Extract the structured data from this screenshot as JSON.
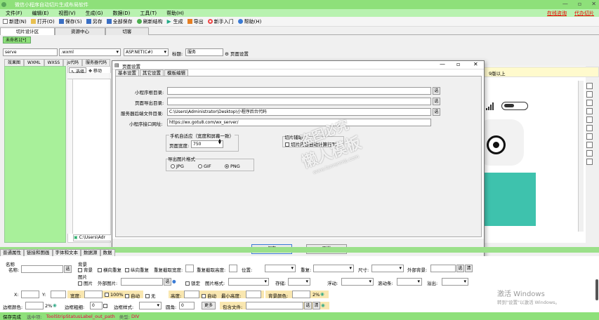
{
  "app": {
    "title": "微信小程序自动切片生成布局软件",
    "window_buttons": [
      "—",
      "▫",
      "✕"
    ]
  },
  "menu": {
    "items": [
      "文件(F)",
      "编辑(E)",
      "视图(V)",
      "生成(G)",
      "数据(D)",
      "工具(T)",
      "帮助(H)"
    ],
    "right_links": [
      "在线咨询",
      "代办切片"
    ]
  },
  "toolbar": {
    "items": [
      "新建(N)",
      "打开(O)",
      "保存(S)",
      "另存",
      "全部保存",
      "刷新结构",
      "生成",
      "导出",
      "新手入门",
      "帮助(H)"
    ]
  },
  "main_tabs": [
    "切片设计区",
    "资源中心",
    "切客"
  ],
  "doc_tab": "未命名1[*]",
  "filebar": {
    "name_value": "serve",
    "ext_value": ".wxml",
    "lang_value": "ASP.NET(C#)",
    "title_label": "标题:",
    "title_value": "服务",
    "page_settings": "页面设置"
  },
  "side_tabs": [
    "效果图",
    "WXML",
    "WXSS",
    "js代码",
    "服务器代码"
  ],
  "design_tools": {
    "select": "选择",
    "move": "移动"
  },
  "path_bottom": "C:\\Users\\Adr",
  "yellow_hint": "9版以上",
  "dialog": {
    "title": "页面设置",
    "tabs": [
      "基本设置",
      "其它设置",
      "模板编辑"
    ],
    "fields": [
      {
        "label": "小程序根目录:",
        "value": "",
        "btn": "选"
      },
      {
        "label": "页面导出目录:",
        "value": "",
        "btn": "选"
      },
      {
        "label": "服务器后端文件目录:",
        "value": "C:\\Users\\Administrator\\Desktop\\小程序后台代码",
        "btn": "选"
      },
      {
        "label": "小程序接口网址:",
        "value": "https://wx.gotu8.com/wx_server/",
        "btn": ""
      }
    ],
    "group_adapt": {
      "title": "手机自适应（宽度和屏幕一致）",
      "width_label": "页面宽度:",
      "width_value": "750"
    },
    "group_assist": {
      "title": "切片辅助",
      "check_label": "切片内容自动计算行列"
    },
    "group_export": {
      "title": "导出图片格式",
      "options": [
        "JPG",
        "GIF",
        "PNG"
      ],
      "selected": "PNG"
    },
    "ok": "保存",
    "cancel": "取消"
  },
  "props": {
    "tabs": [
      "普通属性",
      "链接和图画",
      "字体和文本",
      "数据源",
      "数据"
    ],
    "row1": {
      "name_label": "名称",
      "name_label2": "名称:",
      "bg_label": "背景",
      "bg_check": "背景",
      "repeat": "横向重复",
      "vrepeat": "纵向重复",
      "rep_w": "重复截取宽度:",
      "rep_h": "重复截取高度:",
      "pos": "位置:",
      "rep": "重复:",
      "size": "尺寸:",
      "outer_bg": "外部背景:",
      "btn_sel": "选",
      "btn_clear": "清"
    },
    "row2": {
      "img_title": "图片",
      "img_check": "图片",
      "outer_img": "外部图片:",
      "lock": "锁定",
      "img_fmt": "图片格式:",
      "store": "存储:",
      "float": "浮动:",
      "scroll": "滚动条:",
      "overflow": "溢出:",
      "btn_sel": "选",
      "btn_clear": "清"
    },
    "row3": {
      "x": "X:",
      "y": "Y:",
      "width": "宽度:",
      "pct": "100%",
      "auto": "自动",
      "none": "无",
      "height": "高度:",
      "auto2": "自动",
      "min_h": "最小高度:",
      "bg_color": "背景颜色:",
      "pct2": "2%"
    },
    "row4": {
      "border_color": "边框颜色:",
      "pct": "2%",
      "border_w": "边框粗细:",
      "bw_val": "0",
      "border_style": "边框样式:",
      "radius": "圆角:",
      "radius_val": "0",
      "more": "更多",
      "wrap_file": "包含文件:",
      "btn_sel": "选",
      "btn_clear": "清"
    }
  },
  "status": {
    "ready": "保存完成",
    "selected_label": "选中项:",
    "selected_value": "ToolStripStatusLabel_out_path",
    "type_label": "类型:",
    "type_value": "DIV"
  },
  "watermark": {
    "line1": "盗图必究",
    "line2": "懒人模板",
    "line3": "www.lanrenmb.com"
  },
  "windows_activation": {
    "line1": "激活 Windows",
    "line2": "转到\"设置\"以激活 Windows。"
  },
  "colors": {
    "green": "#8ee07a",
    "light_green": "#b8f2b0",
    "teal": "#3ec2ad"
  }
}
